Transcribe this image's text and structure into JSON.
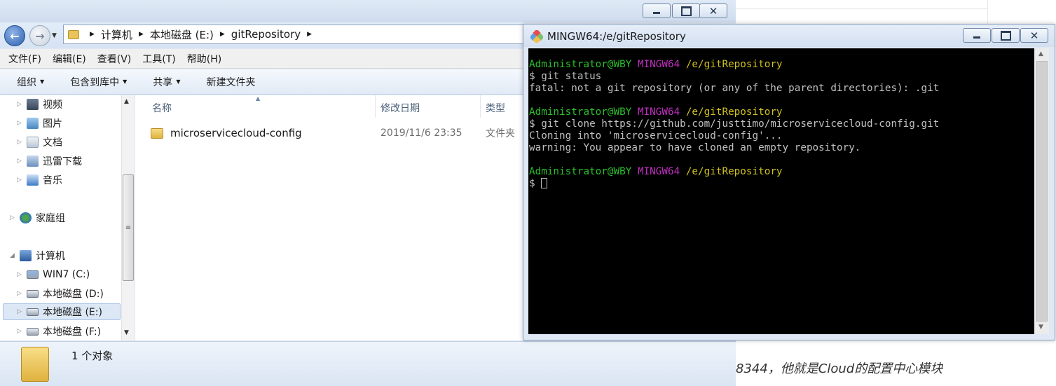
{
  "explorer": {
    "nav": {
      "path": [
        "计算机",
        "本地磁盘 (E:)",
        "gitRepository"
      ]
    },
    "menu": [
      "文件(F)",
      "编辑(E)",
      "查看(V)",
      "工具(T)",
      "帮助(H)"
    ],
    "toolbar": {
      "organize": "组织",
      "include_in_library": "包含到库中",
      "share": "共享",
      "new_folder": "新建文件夹"
    },
    "sidebar": {
      "items": [
        {
          "label": "视频",
          "icon": "video-library-icon"
        },
        {
          "label": "图片",
          "icon": "pictures-library-icon"
        },
        {
          "label": "文档",
          "icon": "documents-library-icon"
        },
        {
          "label": "迅雷下载",
          "icon": "download-folder-icon"
        },
        {
          "label": "音乐",
          "icon": "music-library-icon"
        },
        {
          "label": "家庭组",
          "icon": "homegroup-icon"
        },
        {
          "label": "计算机",
          "icon": "computer-icon"
        },
        {
          "label": "WIN7 (C:)",
          "icon": "system-drive-icon"
        },
        {
          "label": "本地磁盘 (D:)",
          "icon": "drive-icon"
        },
        {
          "label": "本地磁盘 (E:)",
          "icon": "drive-icon",
          "selected": true
        },
        {
          "label": "本地磁盘 (F:)",
          "icon": "drive-icon"
        }
      ]
    },
    "columns": {
      "name": "名称",
      "modified": "修改日期",
      "type": "类型"
    },
    "files": [
      {
        "name": "microservicecloud-config",
        "modified": "2019/11/6 23:35",
        "type": "文件夹"
      }
    ],
    "status": {
      "count": "1 个对象"
    }
  },
  "terminal": {
    "title": "MINGW64:/e/gitRepository",
    "prompt": {
      "user": "Administrator@WBY",
      "system": "MINGW64",
      "cwd": "/e/gitRepository"
    },
    "blocks": [
      {
        "command": "$ git status",
        "output": [
          "fatal: not a git repository (or any of the parent directories): .git"
        ]
      },
      {
        "command": "$ git clone https://github.com/justtimo/microservicecloud-config.git",
        "output": [
          "Cloning into 'microservicecloud-config'...",
          "warning: You appear to have cloned an empty repository."
        ]
      },
      {
        "command": "$ ",
        "output": []
      }
    ]
  },
  "article": {
    "visible_text": "8344，他就是Cloud的配置中心模块"
  },
  "colors": {
    "prompt_user": "#2bbf2b",
    "prompt_system": "#c030c0",
    "prompt_cwd": "#d0c020",
    "terminal_bg": "#000000"
  }
}
